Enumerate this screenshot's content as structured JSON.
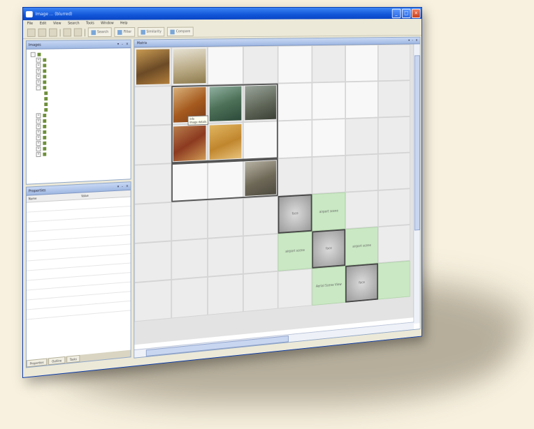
{
  "window": {
    "title": "Image ... (blurred)"
  },
  "menu": {
    "items": [
      "File",
      "Edit",
      "View",
      "Search",
      "Tools",
      "Window",
      "Help"
    ]
  },
  "toolbar": {
    "labeled_buttons": [
      "Search",
      "Filter",
      "Similarity",
      "Compare"
    ]
  },
  "panels": {
    "tree": {
      "title": "Images"
    },
    "properties": {
      "title": "Properties",
      "columns": [
        "Name",
        "Value"
      ]
    },
    "main": {
      "title": "Matrix"
    }
  },
  "matrix": {
    "green_labels": [
      "airport scene",
      "airport scene",
      "airport scene",
      "Aerial Scene View"
    ],
    "gray_labels": [
      "face",
      "face",
      "face"
    ]
  },
  "tooltip": {
    "lines": [
      "Info",
      "Image details"
    ]
  },
  "tabs": [
    "Properties",
    "Outline",
    "Tasks"
  ]
}
